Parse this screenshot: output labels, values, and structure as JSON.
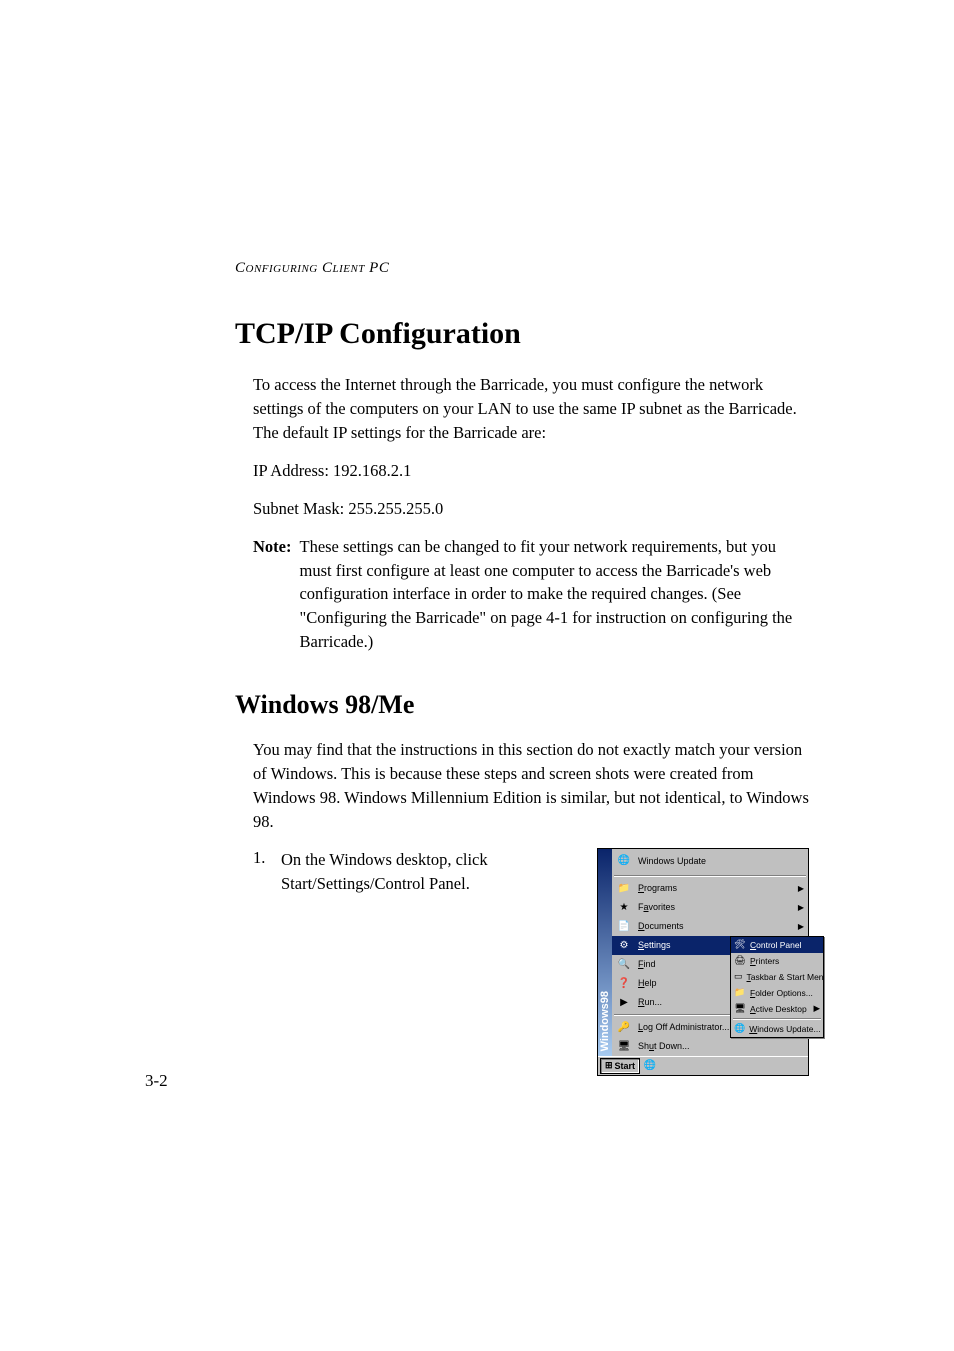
{
  "header": {
    "running": "Configuring Client PC"
  },
  "sections": {
    "s1": {
      "title": "TCP/IP Configuration",
      "p1": "To access the Internet through the Barricade, you must configure the network settings of the computers on your LAN to use the same IP subnet as the Barricade. The default IP settings for the Barricade are:",
      "ip": "IP Address: 192.168.2.1",
      "mask": "Subnet Mask: 255.255.255.0",
      "note_label": "Note:",
      "note_body": "These settings can be changed to fit your network requirements, but you must first configure at least one computer to access the Barricade's web configuration interface in order to make the required changes. (See \"Configuring the Barricade\" on page 4-1 for instruction on configuring the Barricade.)"
    },
    "s2": {
      "title": "Windows 98/Me",
      "p1": "You may find that the instructions in this section do not exactly match your version of Windows. This is because these steps and screen shots were created from Windows 98. Windows Millennium Edition is similar, but not identical, to Windows 98.",
      "step1_num": "1.",
      "step1_text": "On the Windows desktop, click Start/Settings/Control Panel."
    }
  },
  "screenshot": {
    "stripe": "Windows98",
    "menu": {
      "windows_update": "Windows Update",
      "programs": "Programs",
      "favorites": "Favorites",
      "documents": "Documents",
      "settings": "Settings",
      "find": "Find",
      "help": "Help",
      "run": "Run...",
      "logoff": "Log Off Administrator...",
      "shutdown": "Shut Down..."
    },
    "submenu": {
      "control_panel": "Control Panel",
      "printers": "Printers",
      "taskbar": "Taskbar & Start Menu...",
      "folder_options": "Folder Options...",
      "active_desktop": "Active Desktop",
      "windows_update": "Windows Update..."
    },
    "taskbar": {
      "start": "Start"
    }
  },
  "page_number": "3-2"
}
